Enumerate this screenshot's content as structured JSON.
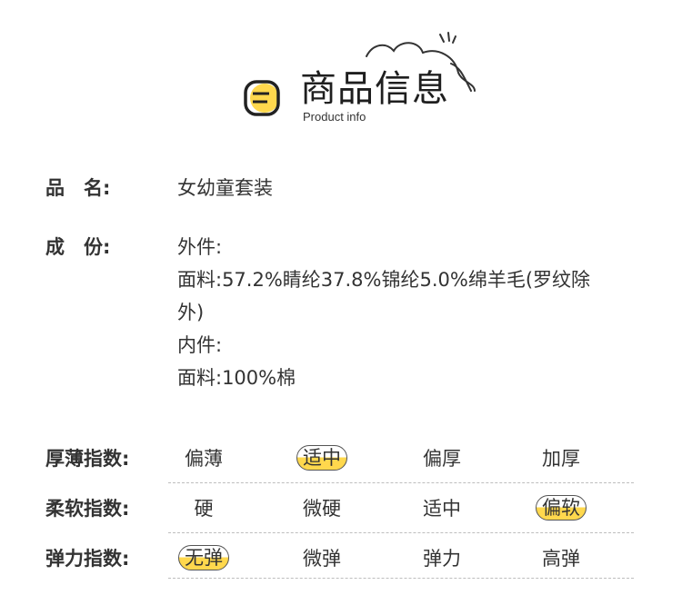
{
  "header": {
    "title": "商品信息",
    "subtitle": "Product info"
  },
  "product": {
    "label": "品　名:",
    "value": "女幼童套装"
  },
  "composition": {
    "label": "成　份:",
    "lines": [
      "外件:",
      "面料:57.2%睛纶37.8%锦纶5.0%绵羊毛(罗纹除",
      "外)",
      "内件:",
      "面料:100%棉"
    ]
  },
  "ratings": [
    {
      "label": "厚薄指数:",
      "options": [
        "偏薄",
        "适中",
        "偏厚",
        "加厚"
      ],
      "selected_index": 1
    },
    {
      "label": "柔软指数:",
      "options": [
        "硬",
        "微硬",
        "适中",
        "偏软"
      ],
      "selected_index": 3
    },
    {
      "label": "弹力指数:",
      "options": [
        "无弹",
        "微弹",
        "弹力",
        "高弹"
      ],
      "selected_index": 0
    }
  ],
  "colors": {
    "highlight": "#ffd84d",
    "text": "#333333",
    "divider": "#bdbdbd"
  }
}
